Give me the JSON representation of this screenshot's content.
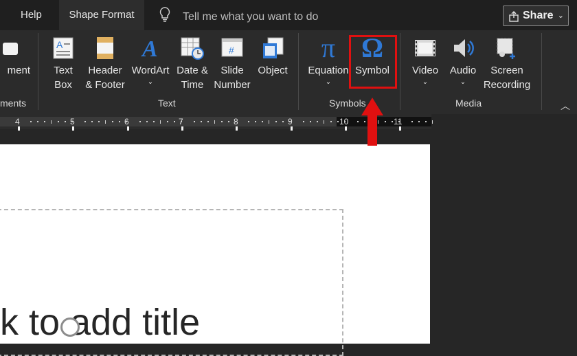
{
  "tabs": {
    "help": "Help",
    "shape_format": "Shape Format"
  },
  "tell_me": {
    "placeholder": "Tell me what you want to do",
    "icon": "lightbulb-icon"
  },
  "share": {
    "label": "Share",
    "icon": "share-icon"
  },
  "ribbon": {
    "partial_left": {
      "label": "ment",
      "group_label": "ments"
    },
    "text_group": {
      "label": "Text",
      "buttons": [
        {
          "line1": "Text",
          "line2": "Box",
          "icon": "textbox-icon"
        },
        {
          "line1": "Header",
          "line2": "& Footer",
          "icon": "header-footer-icon"
        },
        {
          "line1": "WordArt",
          "line2": "⌄",
          "icon": "wordart-icon"
        },
        {
          "line1": "Date &",
          "line2": "Time",
          "icon": "date-time-icon"
        },
        {
          "line1": "Slide",
          "line2": "Number",
          "icon": "slide-number-icon"
        },
        {
          "line1": "Object",
          "line2": "",
          "icon": "object-icon"
        }
      ]
    },
    "symbols_group": {
      "label": "Symbols",
      "buttons": [
        {
          "line1": "Equation",
          "line2": "⌄",
          "glyph": "π",
          "icon": "pi-icon"
        },
        {
          "line1": "Symbol",
          "line2": "",
          "glyph": "Ω",
          "icon": "omega-icon"
        }
      ]
    },
    "media_group": {
      "label": "Media",
      "buttons": [
        {
          "line1": "Video",
          "line2": "⌄",
          "icon": "video-icon"
        },
        {
          "line1": "Audio",
          "line2": "⌄",
          "icon": "audio-icon"
        },
        {
          "line1": "Screen",
          "line2": "Recording",
          "icon": "screen-recording-icon"
        }
      ]
    },
    "collapse_icon": "chevron-up-icon"
  },
  "ruler": {
    "numbers": [
      "4",
      "5",
      "6",
      "7",
      "8",
      "9",
      "10",
      "11"
    ]
  },
  "slide": {
    "title_placeholder": "k to add title"
  },
  "colors": {
    "accent_blue": "#2f79d6",
    "highlight_red": "#e01010"
  }
}
